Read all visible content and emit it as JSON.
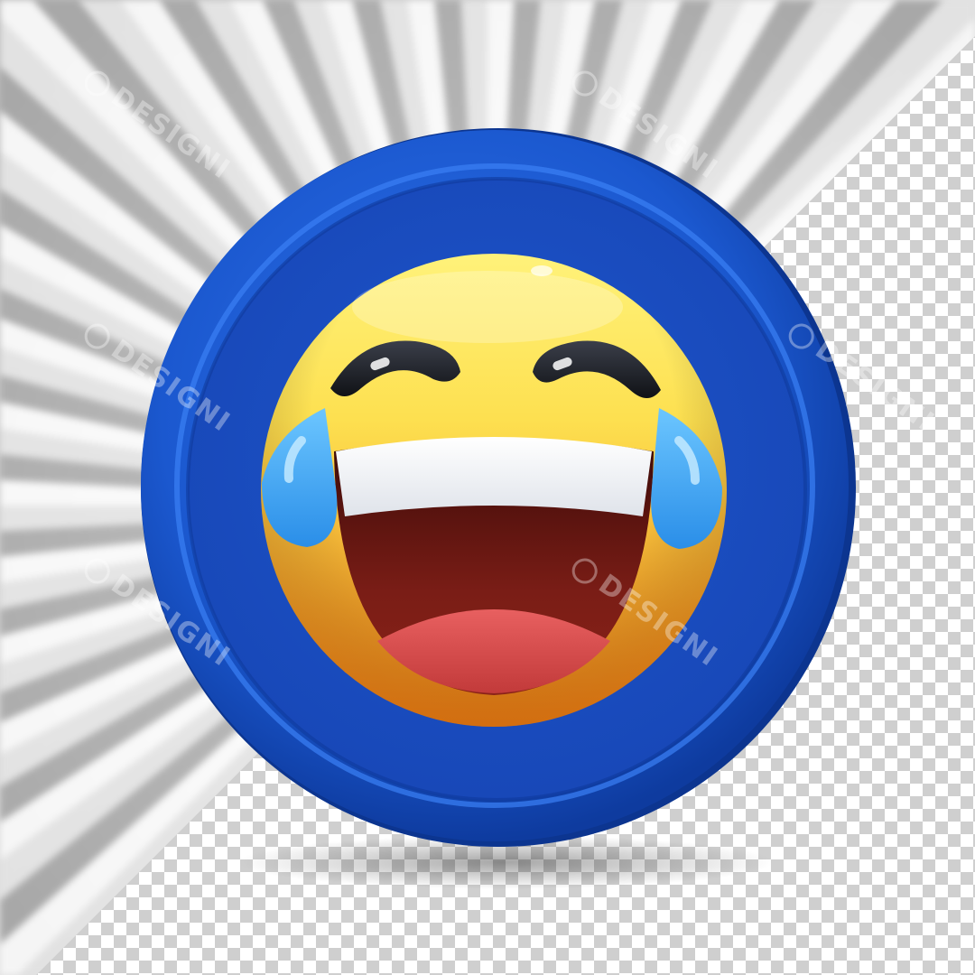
{
  "image": {
    "subject": "laughing-crying-emoji-badge",
    "colors": {
      "badge_blue": "#1f5fd6",
      "badge_blue_dark": "#0f3ea8",
      "face_yellow": "#fde050",
      "face_orange": "#f08a1c",
      "tear_blue": "#3aa8f0",
      "mouth_dark": "#6a1a14",
      "tongue_red": "#d84848",
      "teeth_white": "#ffffff"
    }
  },
  "watermark": {
    "text": "DESIGNI",
    "icon": "designi-logo-icon"
  }
}
